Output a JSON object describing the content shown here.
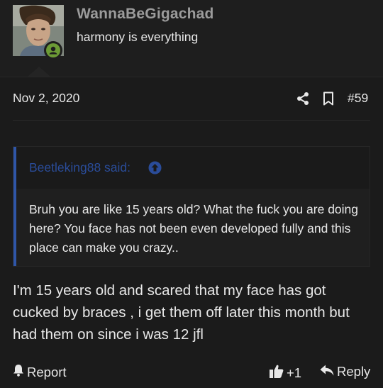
{
  "user": {
    "username": "WannaBeGigachad",
    "title": "harmony is everything",
    "avatar_description": "avatar",
    "status_icon": "user-online-icon",
    "status_color": "#6c9b36"
  },
  "post": {
    "date": "Nov 2, 2020",
    "number": "#59",
    "share_icon": "share-icon",
    "bookmark_icon": "bookmark-icon"
  },
  "quote": {
    "author_text": "Beetleking88 said:",
    "jump_icon": "arrow-up-circle-icon",
    "text": "Bruh you are like 15 years old? What the fuck you are doing here? You face has not been even developed fully and this place can make you crazy..",
    "bar_color": "#2f56a8"
  },
  "message": {
    "text": "I'm 15 years old and scared that my face has got cucked by braces , i get them off later this month but had them on since i was 12 jfl"
  },
  "actions": {
    "report_label": "Report",
    "like_label": "+1",
    "reply_label": "Reply",
    "report_icon": "bell-icon",
    "like_icon": "thumbs-up-icon",
    "reply_icon": "reply-icon"
  }
}
